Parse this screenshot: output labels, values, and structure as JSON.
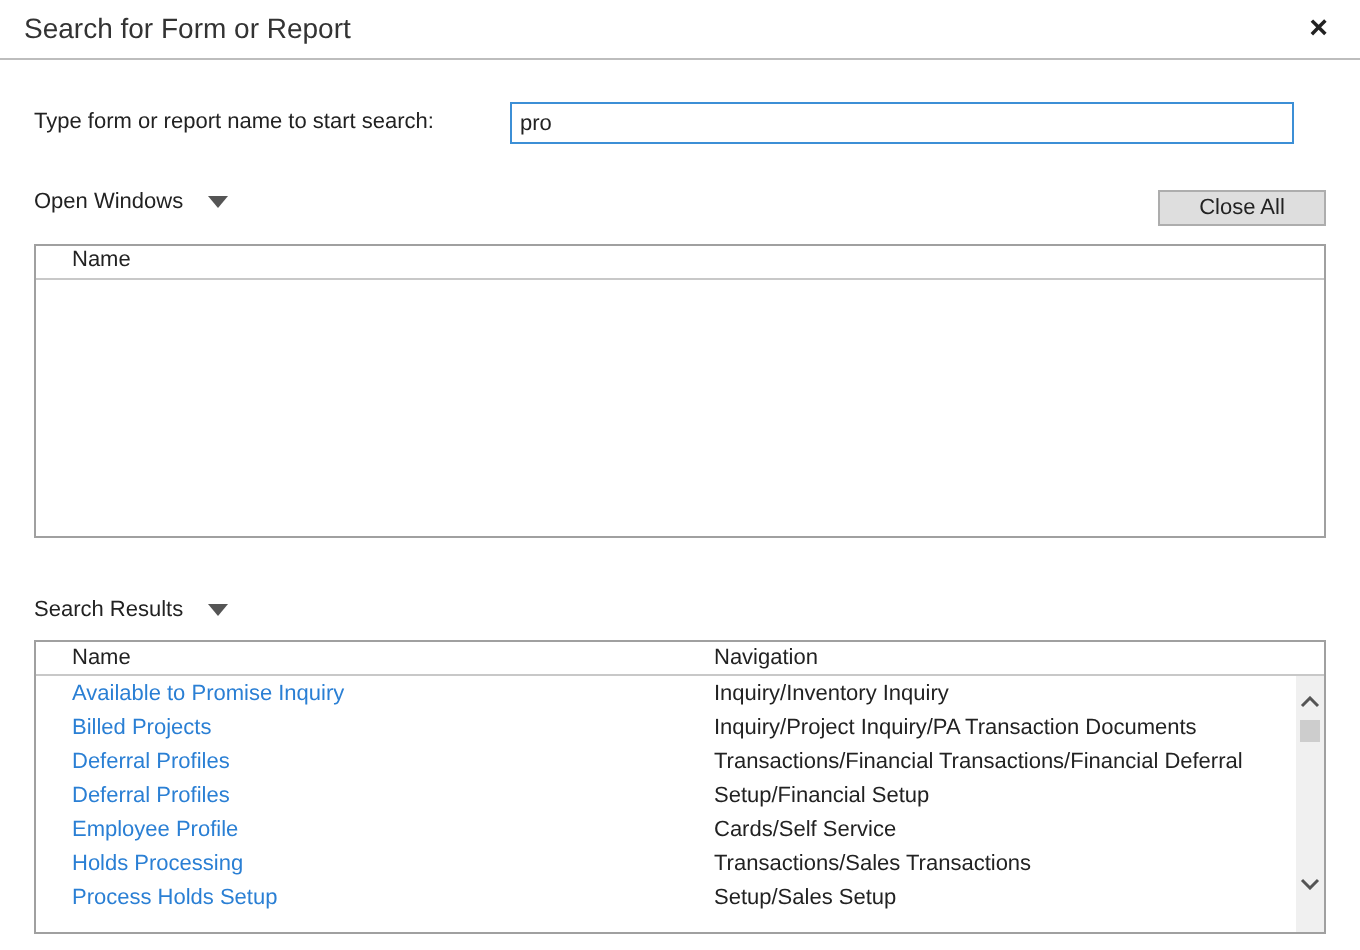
{
  "window": {
    "title": "Search for Form or Report",
    "close": "×"
  },
  "search": {
    "label": "Type form or report name to start search:",
    "value": "pro"
  },
  "open_windows": {
    "label": "Open Windows",
    "expanded": true,
    "close_all": "Close All",
    "columns": [
      "Name"
    ]
  },
  "search_results": {
    "label": "Search Results",
    "expanded": true,
    "columns": [
      "Name",
      "Navigation"
    ],
    "rows": [
      {
        "name": "Available to Promise Inquiry",
        "navigation": "Inquiry/Inventory Inquiry"
      },
      {
        "name": "Billed Projects",
        "navigation": "Inquiry/Project Inquiry/PA Transaction Documents"
      },
      {
        "name": "Deferral Profiles",
        "navigation": "Transactions/Financial Transactions/Financial Deferral"
      },
      {
        "name": "Deferral Profiles",
        "navigation": "Setup/Financial Setup"
      },
      {
        "name": "Employee Profile",
        "navigation": "Cards/Self Service"
      },
      {
        "name": "Holds Processing",
        "navigation": "Transactions/Sales Transactions"
      },
      {
        "name": "Process Holds Setup",
        "navigation": "Setup/Sales Setup"
      }
    ]
  }
}
